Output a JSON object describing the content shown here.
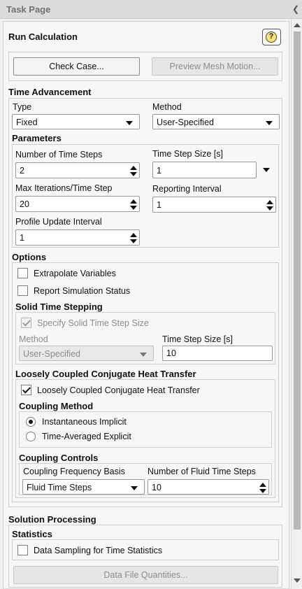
{
  "header": {
    "title": "Task Page"
  },
  "run": {
    "title": "Run Calculation",
    "check_case_label": "Check Case...",
    "preview_mesh_label": "Preview Mesh Motion..."
  },
  "time_advancement": {
    "title": "Time Advancement",
    "type_label": "Type",
    "type_value": "Fixed",
    "method_label": "Method",
    "method_value": "User-Specified"
  },
  "parameters": {
    "title": "Parameters",
    "num_time_steps_label": "Number of Time Steps",
    "num_time_steps_value": "2",
    "time_step_size_label": "Time Step Size [s]",
    "time_step_size_value": "1",
    "max_iter_label": "Max Iterations/Time Step",
    "max_iter_value": "20",
    "reporting_interval_label": "Reporting Interval",
    "reporting_interval_value": "1",
    "profile_update_label": "Profile Update Interval",
    "profile_update_value": "1"
  },
  "options": {
    "title": "Options",
    "extrapolate_label": "Extrapolate Variables",
    "report_status_label": "Report Simulation Status",
    "solid": {
      "title": "Solid Time Stepping",
      "specify_label": "Specify Solid Time Step Size",
      "method_label": "Method",
      "method_value": "User-Specified",
      "step_size_label": "Time Step Size [s]",
      "step_size_value": "10"
    },
    "lcht": {
      "title": "Loosely Coupled Conjugate Heat Transfer",
      "checkbox_label": "Loosely Coupled Conjugate Heat Transfer",
      "coupling_method_title": "Coupling Method",
      "radio_implicit": "Instantaneous Implicit",
      "radio_explicit": "Time-Averaged Explicit",
      "coupling_controls_title": "Coupling Controls",
      "freq_basis_label": "Coupling Frequency Basis",
      "freq_basis_value": "Fluid Time Steps",
      "num_fluid_steps_label": "Number of Fluid Time Steps",
      "num_fluid_steps_value": "10"
    }
  },
  "solution_processing": {
    "title": "Solution Processing",
    "statistics_title": "Statistics",
    "data_sampling_label": "Data Sampling for Time Statistics",
    "data_file_label": "Data File Quantities..."
  },
  "icons": {
    "help": "help-icon",
    "collapse": "collapse-icon",
    "dropdown": "chevron-down-icon"
  }
}
